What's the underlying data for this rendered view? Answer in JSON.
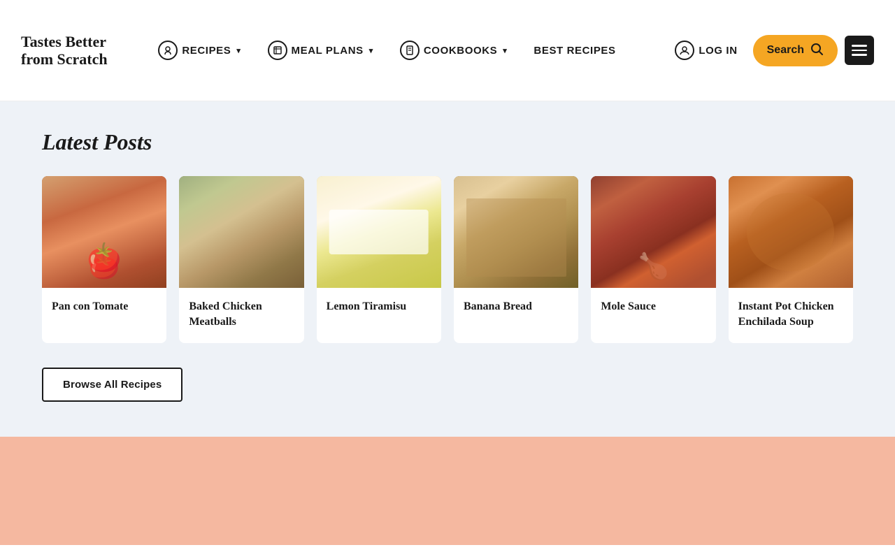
{
  "header": {
    "logo": {
      "line1": "Tastes Better",
      "line2": "from Scratch"
    },
    "nav": {
      "recipes": {
        "label": "RECIPES",
        "hasIcon": true,
        "hasArrow": true
      },
      "mealPlans": {
        "label": "MEAL PLANS",
        "hasIcon": true,
        "hasArrow": true
      },
      "cookbooks": {
        "label": "COOKBOOKS",
        "hasIcon": true,
        "hasArrow": true
      },
      "bestRecipes": {
        "label": "BEST RECIPES",
        "hasIcon": false,
        "hasArrow": false
      },
      "login": {
        "label": "LOG IN"
      },
      "search": {
        "label": "Search"
      },
      "menuLabel": "menu"
    }
  },
  "main": {
    "latestPosts": {
      "title": "Latest Posts",
      "browseBtn": "Browse All Recipes",
      "posts": [
        {
          "id": "pan-con-tomate",
          "title": "Pan con Tomate",
          "imgClass": "img-pan-con-tomate"
        },
        {
          "id": "baked-chicken-meatballs",
          "title": "Baked Chicken Meatballs",
          "imgClass": "img-chicken-meatballs"
        },
        {
          "id": "lemon-tiramisu",
          "title": "Lemon Tiramisu",
          "imgClass": "img-lemon-tiramisu"
        },
        {
          "id": "banana-bread",
          "title": "Banana Bread",
          "imgClass": "img-banana-bread"
        },
        {
          "id": "mole-sauce",
          "title": "Mole Sauce",
          "imgClass": "img-mole-sauce"
        },
        {
          "id": "instant-pot-chicken-enchilada-soup",
          "title": "Instant Pot Chicken Enchilada Soup",
          "imgClass": "img-enchilada-soup"
        }
      ]
    }
  },
  "accent_color": "#f5a623",
  "dark_color": "#1a1a1a",
  "bg_light": "#eef2f7",
  "bg_salmon": "#f5b8a0"
}
